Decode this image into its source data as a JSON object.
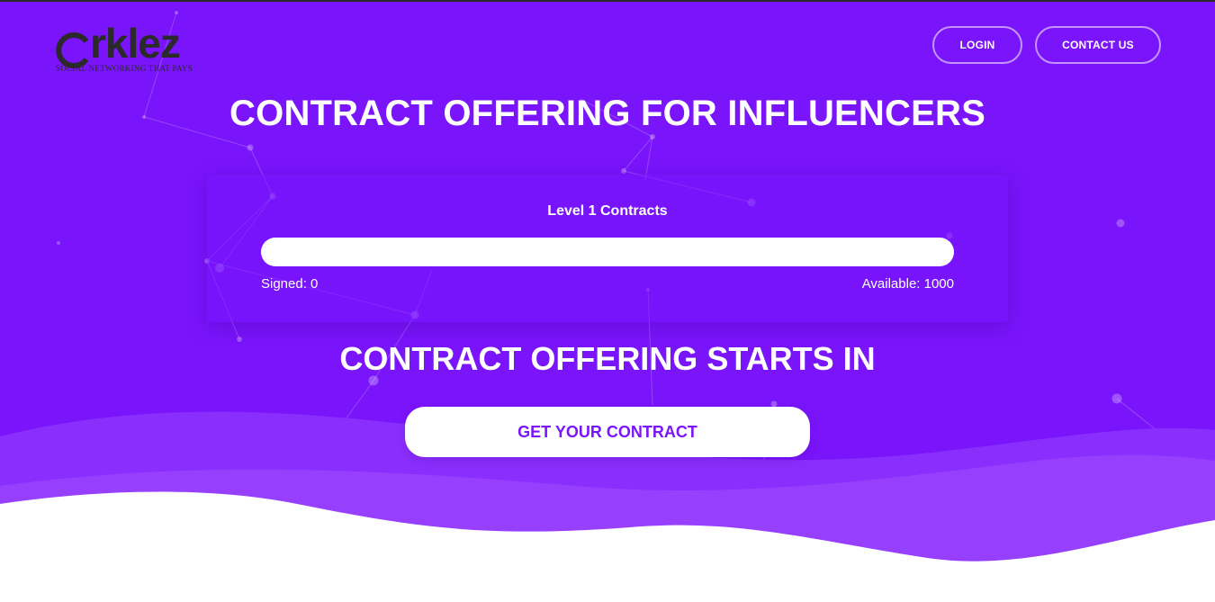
{
  "logo": {
    "word": "rklez",
    "tagline": "SOCIAL NETWORKING THAT PAYS"
  },
  "nav": {
    "login_label": "LOGIN",
    "contact_label": "CONTACT US"
  },
  "hero": {
    "title": "CONTRACT OFFERING FOR INFLUENCERS",
    "subtitle": "CONTRACT OFFERING STARTS IN",
    "cta_label": "GET YOUR CONTRACT"
  },
  "contracts": {
    "title": "Level 1 Contracts",
    "signed_label": "Signed: 0",
    "available_label": "Available: 1000",
    "signed": 0,
    "available": 1000
  },
  "colors": {
    "brand_purple": "#7a14fb",
    "wave_light": "#9640fe",
    "wave_mid": "#8a2efd",
    "logo_dark": "#2a2a2a",
    "white": "#ffffff"
  }
}
